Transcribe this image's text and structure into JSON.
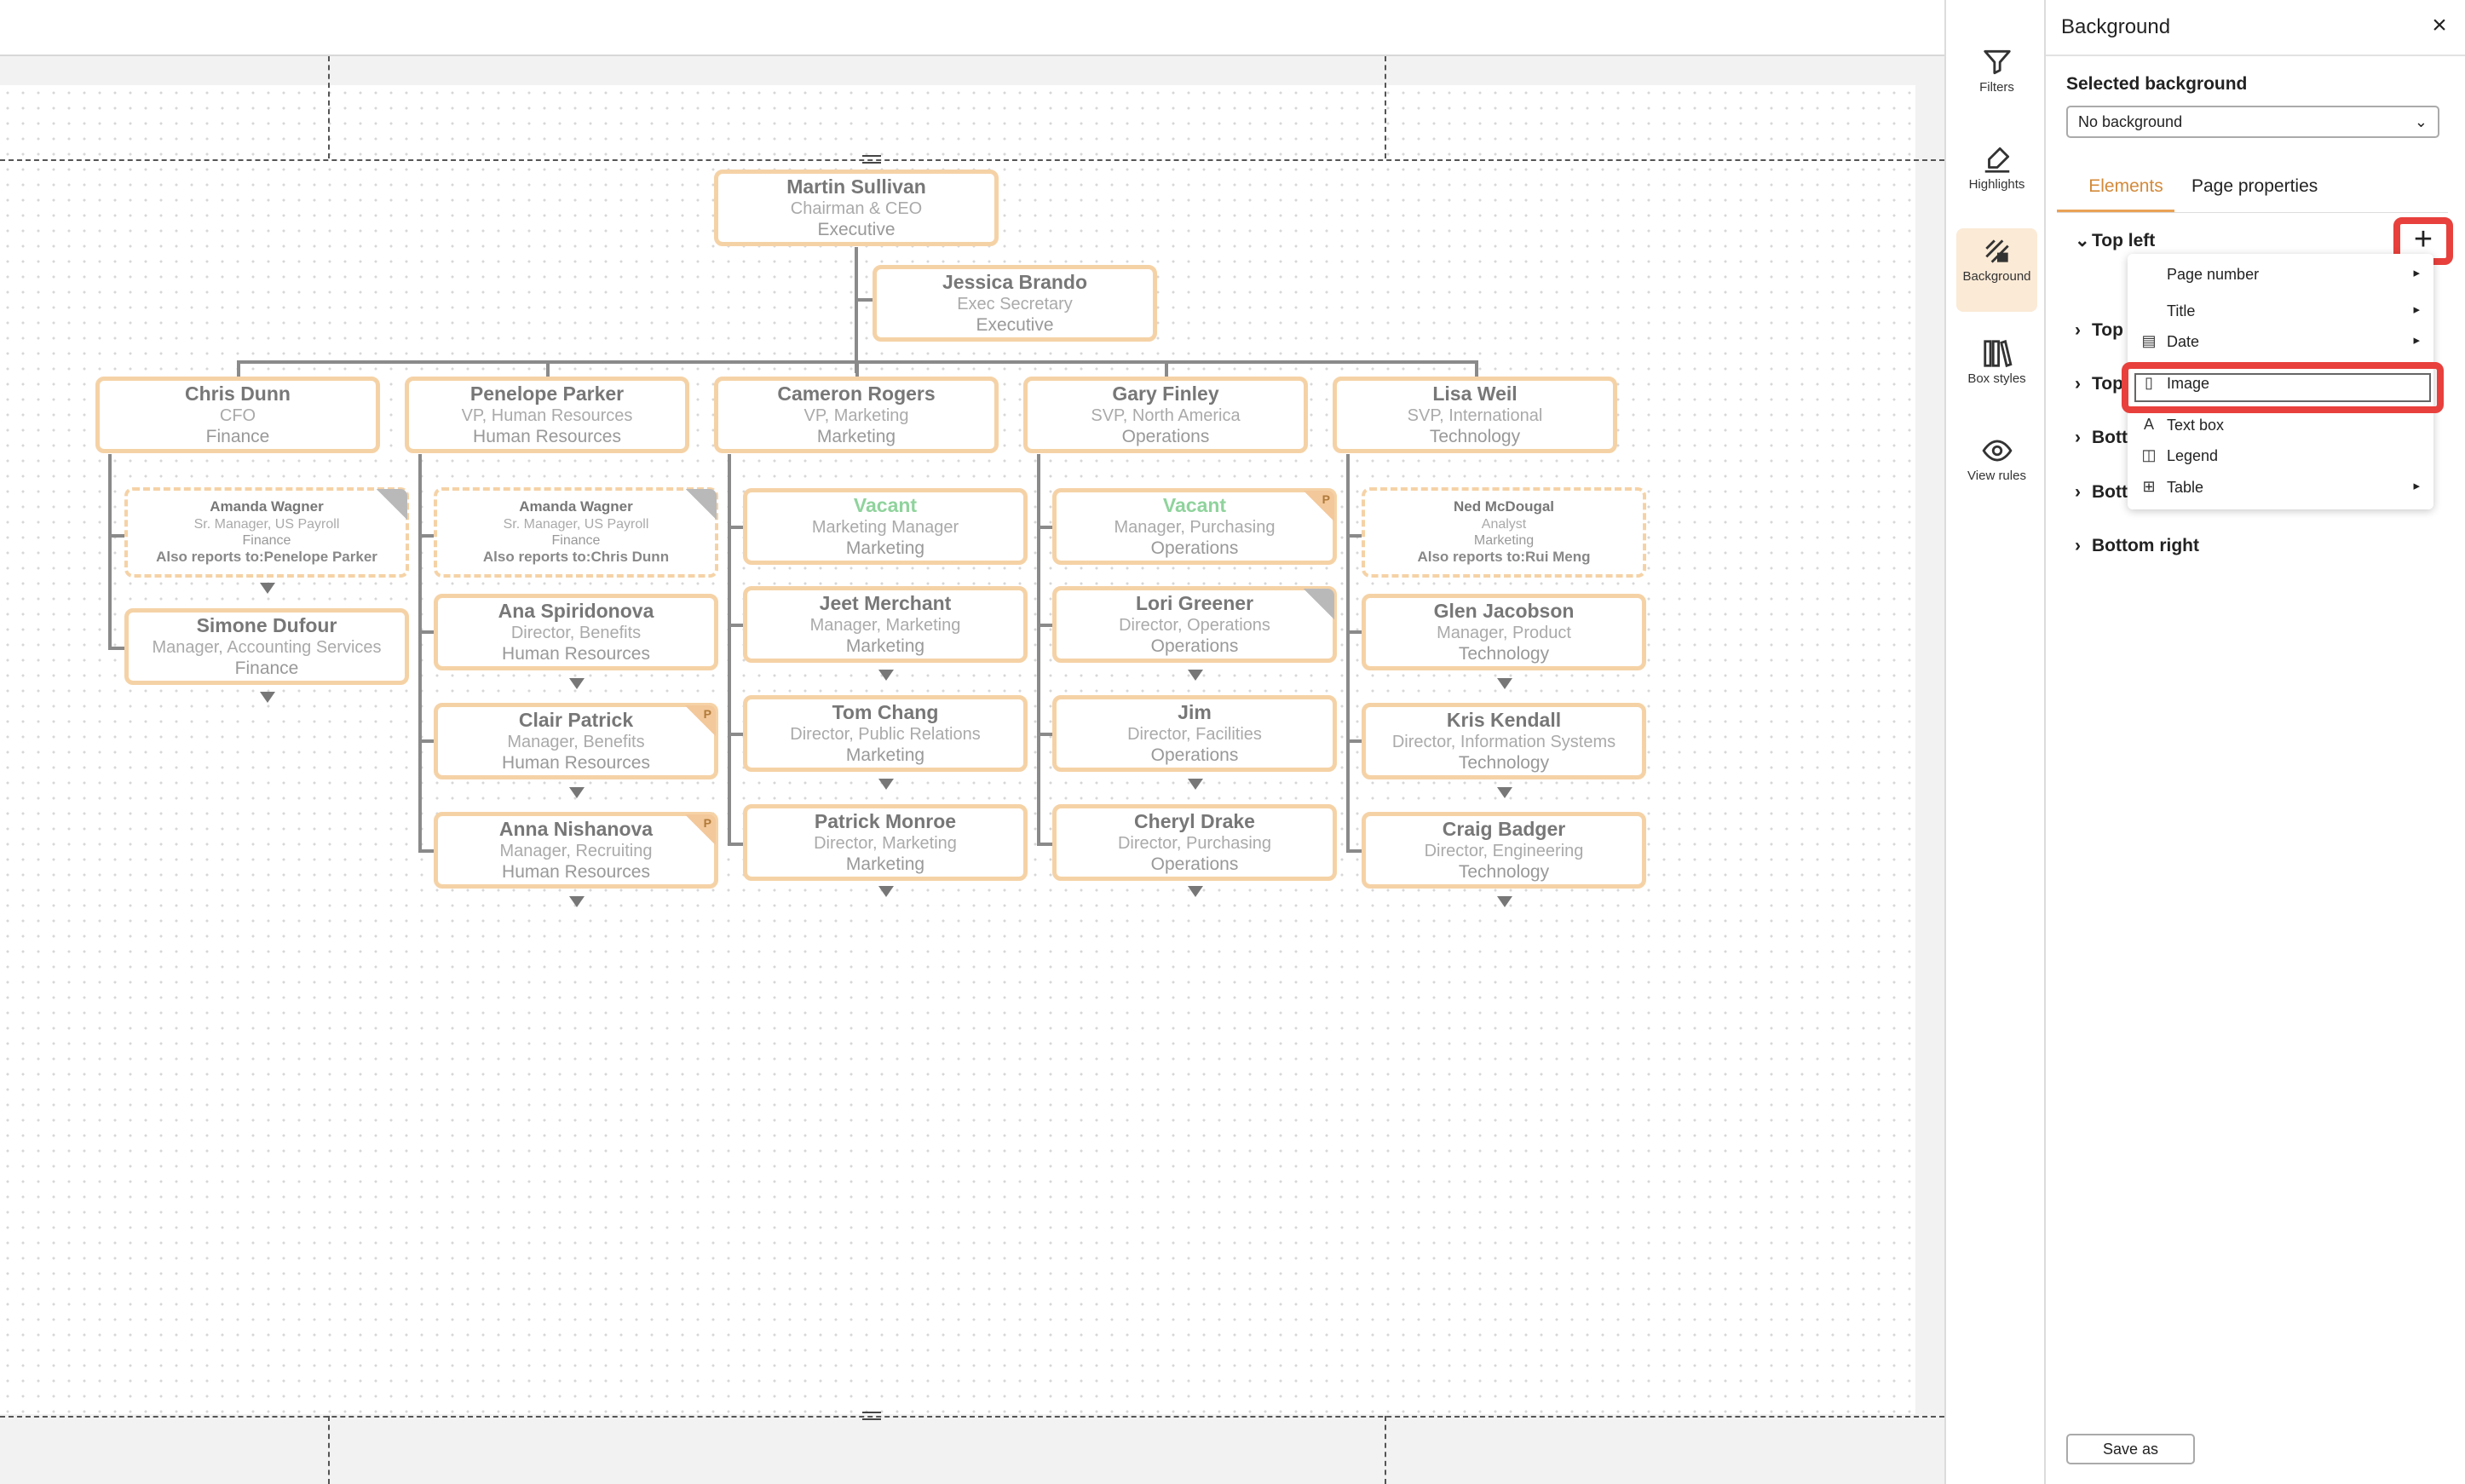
{
  "panel": {
    "title": "Background",
    "selected_background_label": "Selected background",
    "selected_background_value": "No background",
    "tabs": [
      "Elements",
      "Page properties"
    ],
    "sections": [
      "Top left",
      "Top",
      "Top",
      "Bott",
      "Bott",
      "Bottom right"
    ],
    "save_as": "Save as"
  },
  "rail": [
    "Filters",
    "Highlights",
    "Background",
    "Box styles",
    "View rules"
  ],
  "menu": {
    "items": [
      {
        "label": "Page number",
        "icon": "",
        "submenu": true
      },
      {
        "label": "Title",
        "icon": "",
        "submenu": true
      },
      {
        "label": "Date",
        "icon": "calendar-icon",
        "submenu": true
      },
      {
        "label": "Image",
        "icon": "image-icon",
        "submenu": false
      },
      {
        "label": "Text box",
        "icon": "text-icon",
        "submenu": false
      },
      {
        "label": "Legend",
        "icon": "legend-icon",
        "submenu": false
      },
      {
        "label": "Table",
        "icon": "table-icon",
        "submenu": true
      }
    ]
  },
  "org": {
    "ceo": {
      "name": "Martin Sullivan",
      "title": "Chairman & CEO",
      "dept": "Executive"
    },
    "assistant": {
      "name": "Jessica Brando",
      "title": "Exec Secretary",
      "dept": "Executive"
    },
    "vps": [
      {
        "name": "Chris  Dunn",
        "title": "CFO",
        "dept": "Finance"
      },
      {
        "name": "Penelope Parker",
        "title": "VP, Human Resources",
        "dept": "Human Resources"
      },
      {
        "name": "Cameron Rogers",
        "title": "VP, Marketing",
        "dept": "Marketing"
      },
      {
        "name": "Gary Finley",
        "title": "SVP, North America",
        "dept": "Operations"
      },
      {
        "name": "Lisa Weil",
        "title": "SVP, International",
        "dept": "Technology"
      }
    ],
    "col1": [
      {
        "name": "Amanda Wagner",
        "title": "Sr. Manager, US Payroll",
        "dept": "Finance",
        "also": "Also reports to:Penelope Parker"
      },
      {
        "name": "Simone Dufour",
        "title": "Manager, Accounting Services",
        "dept": "Finance"
      }
    ],
    "col2": [
      {
        "name": "Amanda Wagner",
        "title": "Sr. Manager, US Payroll",
        "dept": "Finance",
        "also": "Also reports to:Chris  Dunn"
      },
      {
        "name": "Ana Spiridonova",
        "title": "Director, Benefits",
        "dept": "Human Resources"
      },
      {
        "name": "Clair Patrick",
        "title": "Manager, Benefits",
        "dept": "Human Resources"
      },
      {
        "name": "Anna Nishanova",
        "title": "Manager, Recruiting",
        "dept": "Human Resources"
      }
    ],
    "col3": [
      {
        "name": "Vacant",
        "title": "Marketing Manager",
        "dept": "Marketing"
      },
      {
        "name": "Jeet Merchant",
        "title": "Manager, Marketing",
        "dept": "Marketing"
      },
      {
        "name": "Tom Chang",
        "title": "Director, Public Relations",
        "dept": "Marketing"
      },
      {
        "name": "Patrick Monroe",
        "title": "Director, Marketing",
        "dept": "Marketing"
      }
    ],
    "col4": [
      {
        "name": "Vacant",
        "title": "Manager, Purchasing",
        "dept": "Operations"
      },
      {
        "name": "Lori Greener",
        "title": "Director, Operations",
        "dept": "Operations"
      },
      {
        "name": "Jim",
        "title": "Director, Facilities",
        "dept": "Operations"
      },
      {
        "name": "Cheryl Drake",
        "title": "Director, Purchasing",
        "dept": "Operations"
      }
    ],
    "col5": [
      {
        "name": "Ned McDougal",
        "title": "Analyst",
        "dept": "Marketing",
        "also": "Also reports to:Rui Meng"
      },
      {
        "name": "Glen Jacobson",
        "title": "Manager, Product",
        "dept": "Technology"
      },
      {
        "name": "Kris Kendall",
        "title": "Director, Information Systems",
        "dept": "Technology"
      },
      {
        "name": "Craig Badger",
        "title": "Director, Engineering",
        "dept": "Technology"
      }
    ],
    "badge_letter": "P"
  },
  "colors": {
    "accent": "#e9a256",
    "highlight": "#e8403c",
    "box_border": "#f5d2a6",
    "vacant": "#8fd39c"
  }
}
